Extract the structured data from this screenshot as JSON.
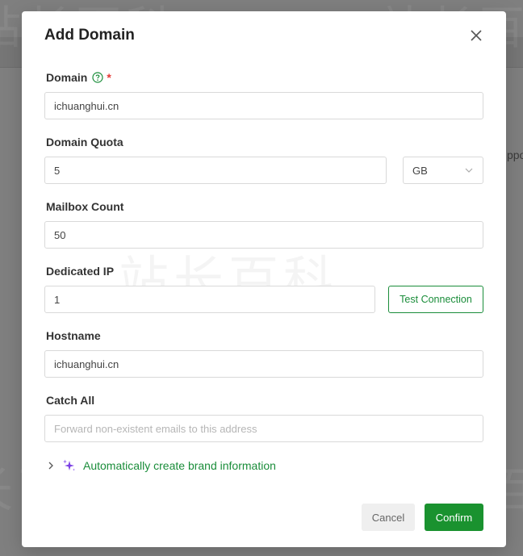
{
  "watermark": "站长百科",
  "backdrop": {
    "partial_text": "ppor"
  },
  "dialog": {
    "title": "Add Domain",
    "fields": {
      "domain": {
        "label": "Domain",
        "required_mark": "*",
        "value": "ichuanghui.cn"
      },
      "quota": {
        "label": "Domain Quota",
        "value": "5",
        "unit": "GB"
      },
      "mailbox": {
        "label": "Mailbox Count",
        "value": "50"
      },
      "ip": {
        "label": "Dedicated IP",
        "value": "1",
        "test_button": "Test Connection"
      },
      "hostname": {
        "label": "Hostname",
        "value": "ichuanghui.cn"
      },
      "catch_all": {
        "label": "Catch All",
        "value": "",
        "placeholder": "Forward non-existent emails to this address"
      }
    },
    "brand_toggle": "Automatically create brand information",
    "cancel": "Cancel",
    "confirm": "Confirm"
  },
  "colors": {
    "accent": "#1a922f",
    "required": "#e53935",
    "sparkle": "#7b3fe4"
  }
}
